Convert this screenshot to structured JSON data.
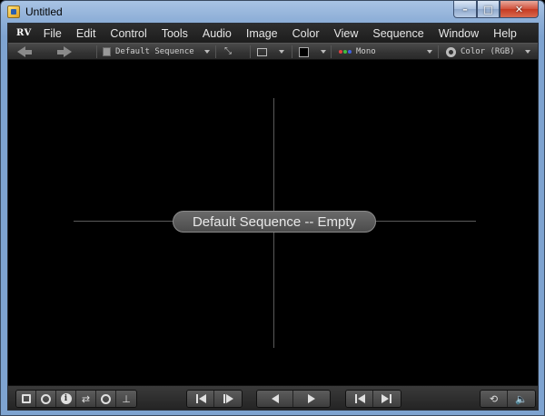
{
  "window": {
    "title": "Untitled",
    "controls": {
      "minimize": "–",
      "maximize": "□",
      "close": "✕"
    }
  },
  "menubar": {
    "logo": "RV",
    "items": [
      "File",
      "Edit",
      "Control",
      "Tools",
      "Audio",
      "Image",
      "Color",
      "View",
      "Sequence",
      "Window",
      "Help"
    ]
  },
  "toolbar": {
    "sequence_select": "Default Sequence",
    "channel_select": "Mono",
    "color_select": "Color (RGB)"
  },
  "viewer": {
    "message": "Default Sequence -- Empty"
  },
  "bottombar": {
    "icons": [
      "panel-icon",
      "color-wheel-icon",
      "info-icon",
      "swap-icon",
      "upload-icon",
      "baseline-icon"
    ],
    "transport": [
      "step-back",
      "step-forward",
      "play-back",
      "play-forward",
      "go-start",
      "go-end"
    ]
  },
  "colors": {
    "menubar_bg": "#1d1d1d",
    "toolbar_bg": "#333333",
    "viewer_bg": "#000000",
    "crosshair": "#5a5a5a",
    "pill_bg": "#5a5a5a",
    "text": "#e6e6e6"
  }
}
